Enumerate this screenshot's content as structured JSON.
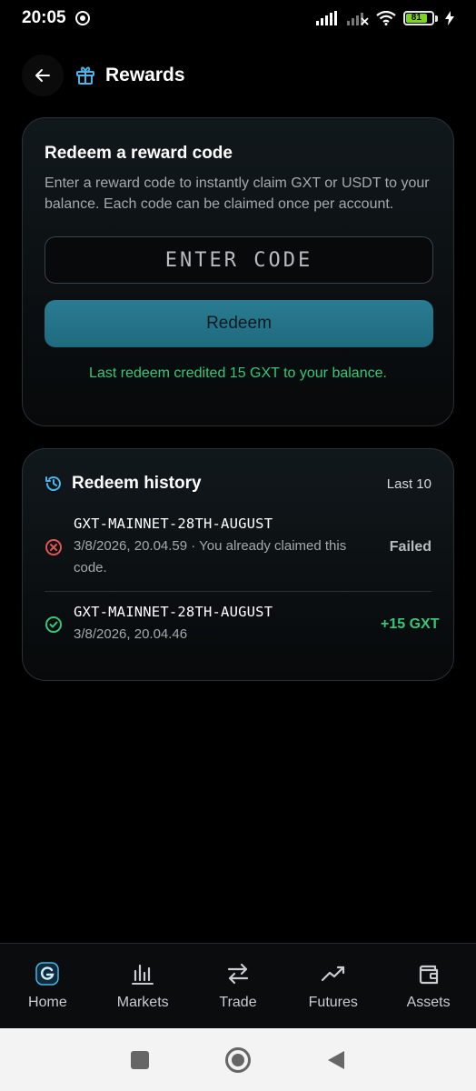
{
  "status_bar": {
    "time": "20:05",
    "battery": "81"
  },
  "header": {
    "title": "Rewards"
  },
  "redeem": {
    "title": "Redeem a reward code",
    "description": "Enter a reward code to instantly claim GXT or USDT to your balance. Each code can be claimed once per account.",
    "input_placeholder": "ENTER CODE",
    "input_value": "",
    "button_label": "Redeem",
    "status_message": "Last redeem credited 15 GXT to your balance."
  },
  "history": {
    "title": "Redeem history",
    "count_label": "Last 10",
    "items": [
      {
        "code": "GXT-MAINNET-28TH-AUGUST",
        "meta": "3/8/2026, 20.04.59 · You already claimed this code.",
        "status": "Failed",
        "state": "error"
      },
      {
        "code": "GXT-MAINNET-28TH-AUGUST",
        "meta": "3/8/2026, 20.04.46",
        "status": "+15 GXT",
        "state": "success"
      }
    ]
  },
  "bottom_nav": {
    "items": [
      {
        "label": "Home",
        "icon": "logo-g-icon"
      },
      {
        "label": "Markets",
        "icon": "bar-chart-icon"
      },
      {
        "label": "Trade",
        "icon": "swap-arrows-icon"
      },
      {
        "label": "Futures",
        "icon": "trend-up-icon"
      },
      {
        "label": "Assets",
        "icon": "wallet-icon"
      }
    ]
  },
  "colors": {
    "accent": "#2a7c92",
    "success": "#34c77b",
    "error": "#e05454",
    "icon_blue": "#4ab3e8"
  }
}
